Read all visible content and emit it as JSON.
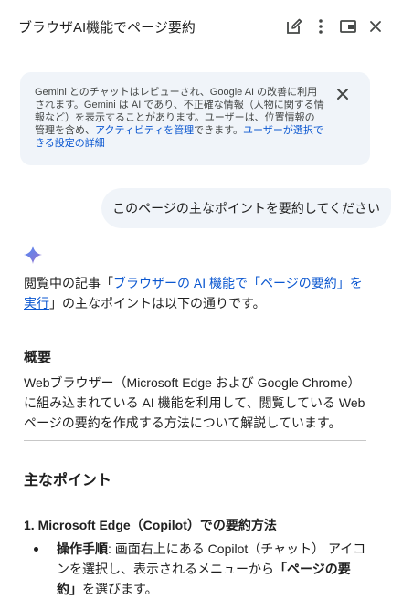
{
  "header": {
    "title": "ブラウザAI機能でページ要約",
    "icons": [
      "edit-icon",
      "more-vert-icon",
      "picture-in-picture-icon",
      "close-icon"
    ]
  },
  "notice": {
    "text_before": "Gemini とのチャットはレビューされ、Google AI の改善に利用されます。Gemini は AI であり、不正確な情報（人物に関する情報など）を表示することがあります。ユーザーは、位置情報の管理を含め、",
    "activity_link": "アクティビティを管理",
    "text_middle": "できます。",
    "settings_link": "ユーザーが選択できる設定の詳細"
  },
  "user_message": "このページの主なポイントを要約してください",
  "response": {
    "intro_before": "閲覧中の記事「",
    "intro_link": "ブラウザーの AI 機能で「ページの要約」を実行",
    "intro_after": "」の主なポイントは以下の通りです。",
    "overview_heading": "概要",
    "overview_text": "Webブラウザー（Microsoft Edge および Google Chrome）に組み込まれている AI 機能を利用して、閲覧している Web ページの要約を作成する方法について解説しています。",
    "main_points_heading": "主なポイント",
    "section1_heading": "1. Microsoft Edge（Copilot）での要約方法",
    "bullet1": {
      "label": "操作手順",
      "text_before": ": 画面右上にある Copilot（チャット） アイコンを選択し、表示されるメニューから",
      "bold_option": "「ページの要約」",
      "text_after": "を選びます。"
    }
  }
}
